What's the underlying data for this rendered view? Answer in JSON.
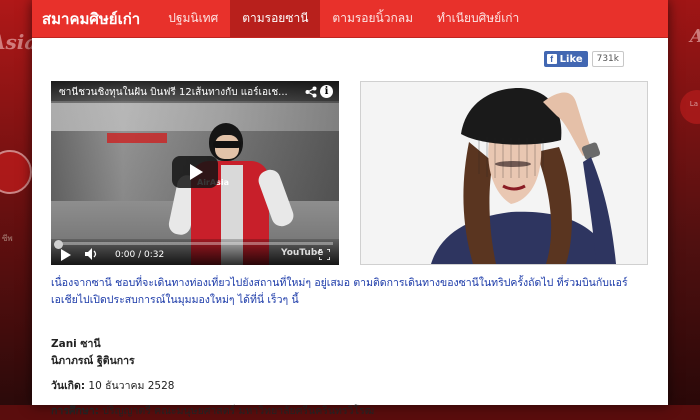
{
  "navbar": {
    "brand": "สมาคมศิษย์เก่า",
    "items": [
      {
        "label": "ปฐมนิเทศ",
        "active": false
      },
      {
        "label": "ตามรอยซานี",
        "active": true
      },
      {
        "label": "ตามรอยนิ้วกลม",
        "active": false
      },
      {
        "label": "ทำเนียบศิษย์เก่า",
        "active": false
      }
    ]
  },
  "like": {
    "label": "Like",
    "count": "731k"
  },
  "video": {
    "title": "ซานีชวนชิงทุนในฝัน บินฟรี 12เส้นทางกับ แอร์เอเช...",
    "time": "0:00 / 0:32",
    "brand_in_scene": "AirAsia",
    "player_logo": "YouTube"
  },
  "intro": "เนื่องจากซานี ชอบที่จะเดินทางท่องเที่ยวไปยังสถานที่ใหม่ๆ อยู่เสมอ ตามติดการเดินทางของซานีในทริปครั้งถัดไป ที่ร่วมบินกับแอร์เอเชียไปเปิดประสบการณ์ในมุมมองใหม่ๆ ได้ที่นี่ เร็วๆ นี้",
  "profile": {
    "name": "Zani ซานี",
    "fullname": "นิภาภรณ์ ฐิตินการ",
    "birth_label": "วันเกิด:",
    "birth_value": "10 ธันวาคม 2528",
    "edu_label": "การศึกษา:",
    "edu_value": "ปริญญาตรี คณะมนุษยศาสตร์ มหาวิทยาลัยศรีนครินทรวิโรฒ"
  },
  "colors": {
    "nav": "#e8312b",
    "nav_active": "#b8201c",
    "link_text": "#1a39a8",
    "fb": "#4267b2"
  }
}
